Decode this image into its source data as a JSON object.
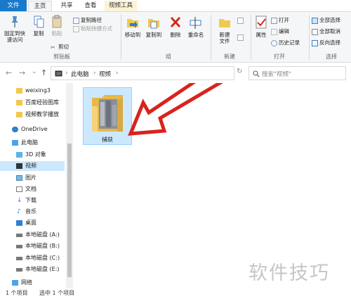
{
  "tabs": {
    "file": "文件",
    "home": "主页",
    "share": "共享",
    "view": "查看",
    "video_tools": "视频工具"
  },
  "ribbon": {
    "clipboard": {
      "pin_quick_access": "固定到快\n速访问",
      "copy": "复制",
      "paste": "粘贴",
      "copy_path": "复制路径",
      "paste_shortcut": "粘贴快捷方式",
      "cut": "剪切",
      "group_label": "剪贴板"
    },
    "organize": {
      "move_to": "移动到",
      "copy_to": "复制到",
      "delete": "删除",
      "rename": "重命名",
      "group_label": "组"
    },
    "new": {
      "new_folder": "新建\n文件",
      "group_label": "新建"
    },
    "open": {
      "properties": "属性",
      "open": "打开",
      "edit": "编辑",
      "history": "历史记录",
      "group_label": "打开"
    },
    "select": {
      "select_all": "全部选择",
      "select_none": "全部取消",
      "invert": "反向选择",
      "group_label": "选择"
    }
  },
  "address": {
    "back": "←",
    "forward": "→",
    "recent": "⌄",
    "up": "↑",
    "crumb_pc": "此电脑",
    "crumb_video": "视频",
    "sep": "›",
    "search_placeholder": "搜索\"视频\""
  },
  "sidebar": {
    "items": [
      {
        "label": "weixing3",
        "icon": "folder-icon"
      },
      {
        "label": "百度经验图库",
        "icon": "folder-icon"
      },
      {
        "label": "视频教学播放",
        "icon": "folder-icon"
      },
      {
        "label": "OneDrive",
        "icon": "cloud-icon"
      },
      {
        "label": "此电脑",
        "icon": "computer-icon"
      },
      {
        "label": "3D 对象",
        "icon": "cube-icon"
      },
      {
        "label": "视频",
        "icon": "video-icon"
      },
      {
        "label": "图片",
        "icon": "picture-icon"
      },
      {
        "label": "文档",
        "icon": "document-icon"
      },
      {
        "label": "下载",
        "icon": "download-icon"
      },
      {
        "label": "音乐",
        "icon": "music-icon"
      },
      {
        "label": "桌面",
        "icon": "desktop-icon"
      },
      {
        "label": "本地磁盘 (A:)",
        "icon": "drive-icon"
      },
      {
        "label": "本地磁盘 (B:)",
        "icon": "drive-icon"
      },
      {
        "label": "本地磁盘 (C:)",
        "icon": "drive-icon"
      },
      {
        "label": "本地磁盘 (E:)",
        "icon": "drive-icon"
      },
      {
        "label": "网络",
        "icon": "network-icon"
      }
    ]
  },
  "content": {
    "folder_name": "捕获"
  },
  "status": {
    "count": "1 个项目",
    "selected": "选中 1 个项目"
  },
  "watermark": "软件技巧",
  "colors": {
    "file_tab": "#1979ca",
    "video_tools_tab": "#fcf3d4",
    "selection": "#cce8ff",
    "arrow": "#d9231c"
  }
}
